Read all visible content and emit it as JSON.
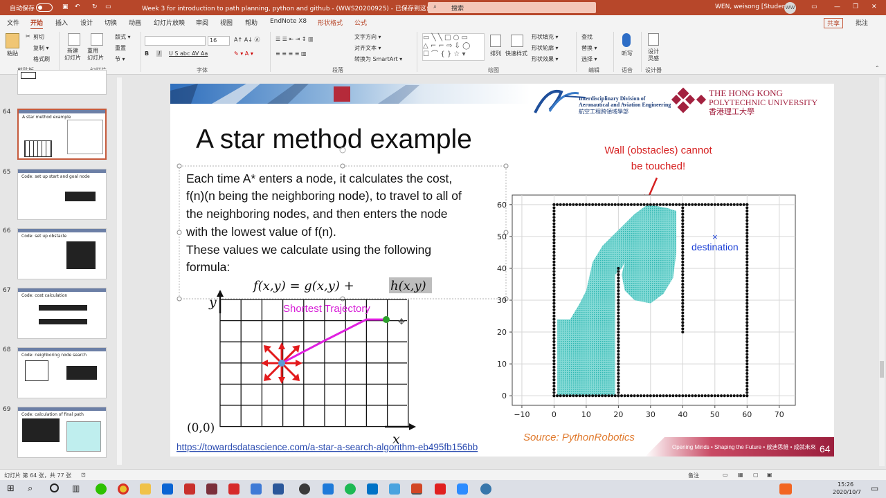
{
  "titlebar": {
    "autosave": "自动保存",
    "toggle": "关",
    "doc_title": "Week 3 for introduction to path planning, python and github - (WWS20200925) - 已保存到这台电脑 ▾",
    "search": "搜索",
    "user": "WEN, weisong [Student]",
    "avatar": "WW"
  },
  "tabs": [
    "文件",
    "开始",
    "插入",
    "设计",
    "切换",
    "动画",
    "幻灯片放映",
    "审阅",
    "视图",
    "帮助",
    "EndNote X8",
    "形状格式",
    "公式"
  ],
  "share": "共享",
  "comments": "批注",
  "ribbon": {
    "clipboard": {
      "paste": "粘贴",
      "cut": "剪切",
      "copy": "复制 ▾",
      "format": "格式刷",
      "label": "剪贴板"
    },
    "slides": {
      "new": "新建\n幻灯片",
      "reuse": "重用\n幻灯片",
      "layout": "版式 ▾",
      "reset": "重置",
      "section": "节 ▾",
      "label": "幻灯片"
    },
    "font": {
      "size": "16",
      "label": "字体"
    },
    "paragraph": {
      "dir": "文字方向 ▾",
      "align": "对齐文本 ▾",
      "smartart": "转换为 SmartArt ▾",
      "label": "段落"
    },
    "drawing": {
      "arrange": "排列",
      "styles": "快速样式",
      "fill": "形状填充 ▾",
      "outline": "形状轮廓 ▾",
      "effect": "形状效果 ▾",
      "label": "绘图"
    },
    "editing": {
      "find": "查找",
      "replace": "替换 ▾",
      "select": "选择 ▾",
      "label": "编辑"
    },
    "voice": {
      "dictate": "听写",
      "label": "语音"
    },
    "designer": {
      "idea": "设计\n灵感",
      "label": "设计器"
    }
  },
  "thumbs": [
    {
      "num": "64",
      "title": "A star method example"
    },
    {
      "num": "65",
      "title": "Code: set up start and goal node"
    },
    {
      "num": "66",
      "title": "Code: set up obstacle"
    },
    {
      "num": "67",
      "title": "Code: cost calculation"
    },
    {
      "num": "68",
      "title": "Code: neighboring node search"
    },
    {
      "num": "69",
      "title": "Code: calculation of final path"
    }
  ],
  "slide": {
    "title": "A star method example",
    "logo_left1": "Interdisciplinary Division of",
    "logo_left2": "Aeronautical and Aviation Engineering",
    "logo_left3": "航空工程跨領域學部",
    "logo_right1": "THE HONG KONG",
    "logo_right2": "POLYTECHNIC UNIVERSITY",
    "logo_right3": "香港理工大學",
    "body": [
      "Each time A* enters a node, it calculates the cost,",
      "f(n)(n being the neighboring node), to travel to all of",
      "the neighboring nodes, and then enters the node",
      "with the lowest value of f(n).",
      "These values we calculate using the following",
      "formula:"
    ],
    "formula_a": "f(x,y)  =  g(x,y)  +",
    "formula_b": "h(x,y)",
    "grid_y": "y",
    "grid_x": "x",
    "origin": "(0,0)",
    "shortest": "Shortest Trajectory",
    "wall_note1": "Wall (obstacles) cannot",
    "wall_note2": "be touched!",
    "dest_label": "destination",
    "source": "Source: PythonRobotics",
    "link": "https://towardsdatascience.com/a-star-a-search-algorithm-eb495fb156bb",
    "footer": "Opening Minds • Shaping the Future • 啟迪思維 • 成就未來",
    "page": "64"
  },
  "chart_data": {
    "type": "scatter",
    "x_ticks": [
      "−10",
      "0",
      "10",
      "20",
      "30",
      "40",
      "50",
      "60",
      "70"
    ],
    "y_ticks": [
      "0",
      "10",
      "20",
      "30",
      "40",
      "50",
      "60"
    ],
    "xlim": [
      -13,
      75
    ],
    "ylim": [
      -3,
      63
    ],
    "grid": true,
    "walls": [
      [
        [
          0,
          0
        ],
        [
          60,
          0
        ]
      ],
      [
        [
          60,
          0
        ],
        [
          60,
          60
        ]
      ],
      [
        [
          60,
          60
        ],
        [
          0,
          60
        ]
      ],
      [
        [
          0,
          60
        ],
        [
          0,
          0
        ]
      ],
      [
        [
          20,
          0
        ],
        [
          20,
          40
        ]
      ],
      [
        [
          40,
          20
        ],
        [
          40,
          60
        ]
      ]
    ],
    "destination": [
      50,
      50
    ],
    "explored_colors": {
      "explored": "#29b5b0",
      "wall": "#111111",
      "destination": "#1a3fd6"
    }
  },
  "status": {
    "left": "幻灯片 第 64 张，共 77 张",
    "notes": "备注",
    "zoom": "",
    "time": "15:26",
    "date": "2020/10/7"
  }
}
